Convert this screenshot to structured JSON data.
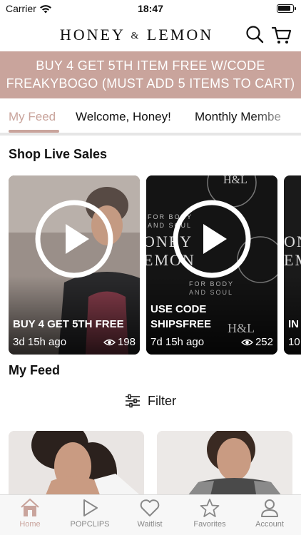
{
  "status_bar": {
    "carrier": "Carrier",
    "time": "18:47",
    "battery_level": 0.9
  },
  "header": {
    "logo_left": "HONEY",
    "logo_amp": "&",
    "logo_right": "LEMON",
    "icons": [
      "search-icon",
      "cart-icon"
    ]
  },
  "promo": {
    "line1": "BUY 4 GET 5TH ITEM FREE W/CODE",
    "line2": "FREAKYBOGO (MUST ADD 5 ITEMS TO CART)"
  },
  "tabs": [
    {
      "label": "My Feed",
      "active": true
    },
    {
      "label": "Welcome, Honey!",
      "active": false
    },
    {
      "label": "Monthly Membe",
      "active": false
    }
  ],
  "live_section": {
    "title": "Shop Live Sales"
  },
  "live_cards": [
    {
      "title": "BUY 4 GET 5TH FREE",
      "age": "3d 15h ago",
      "views": "198"
    },
    {
      "title_line1": "USE CODE",
      "title_line2": "SHIPSFREE",
      "age": "7d 15h ago",
      "views": "252",
      "brand_text": "H&L",
      "brand_word_1": "FOR BODY",
      "brand_word_2": "AND SOUL",
      "brand_big": "ONEY",
      "brand_big_2": "EMON"
    },
    {
      "title": "IN",
      "age": "10",
      "brand_big": "ONE",
      "brand_big_2": "EM"
    }
  ],
  "feed_section": {
    "title": "My Feed",
    "filter_label": "Filter"
  },
  "tab_bar": [
    {
      "label": "Home",
      "icon": "home-icon",
      "active": true
    },
    {
      "label": "POPCLIPS",
      "icon": "play-icon",
      "active": false
    },
    {
      "label": "Waitlist",
      "icon": "heart-icon",
      "active": false
    },
    {
      "label": "Favorites",
      "icon": "star-icon",
      "active": false
    },
    {
      "label": "Account",
      "icon": "user-icon",
      "active": false
    }
  ],
  "colors": {
    "accent": "#c9a49c",
    "inactive": "#888888"
  }
}
